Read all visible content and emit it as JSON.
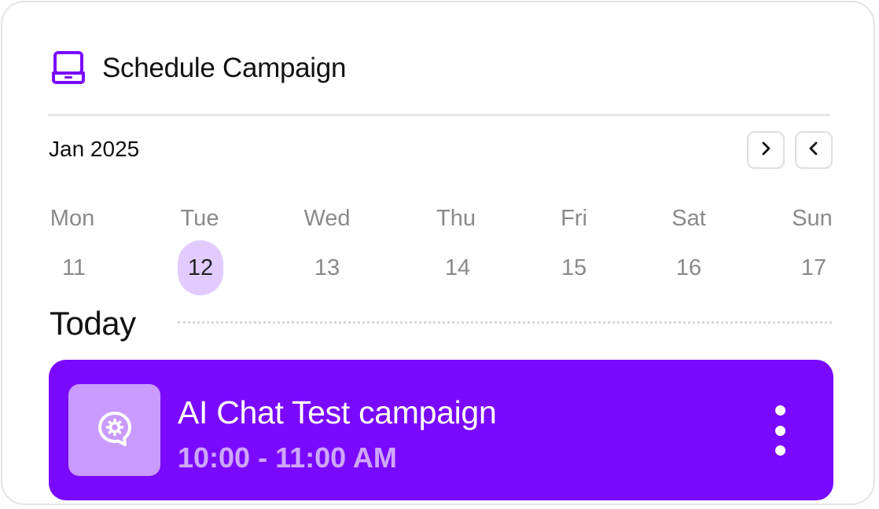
{
  "header": {
    "title": "Schedule Campaign",
    "icon": "laptop-icon",
    "accent": "#7a0aff"
  },
  "calendar": {
    "month_label": "Jan 2025",
    "next_icon": "chevron-right-icon",
    "prev_icon": "chevron-left-icon",
    "days": [
      {
        "name": "Mon",
        "date": "11",
        "selected": false
      },
      {
        "name": "Tue",
        "date": "12",
        "selected": true
      },
      {
        "name": "Wed",
        "date": "13",
        "selected": false
      },
      {
        "name": "Thu",
        "date": "14",
        "selected": false
      },
      {
        "name": "Fri",
        "date": "15",
        "selected": false
      },
      {
        "name": "Sat",
        "date": "16",
        "selected": false
      },
      {
        "name": "Sun",
        "date": "17",
        "selected": false
      }
    ]
  },
  "section": {
    "today_label": "Today"
  },
  "event": {
    "title": "AI Chat Test campaign",
    "time": "10:00 - 11:00 AM",
    "icon": "chat-bot-icon",
    "menu_icon": "more-vertical-icon",
    "bg_color": "#7a0aff",
    "thumb_color": "#c99bfe"
  }
}
